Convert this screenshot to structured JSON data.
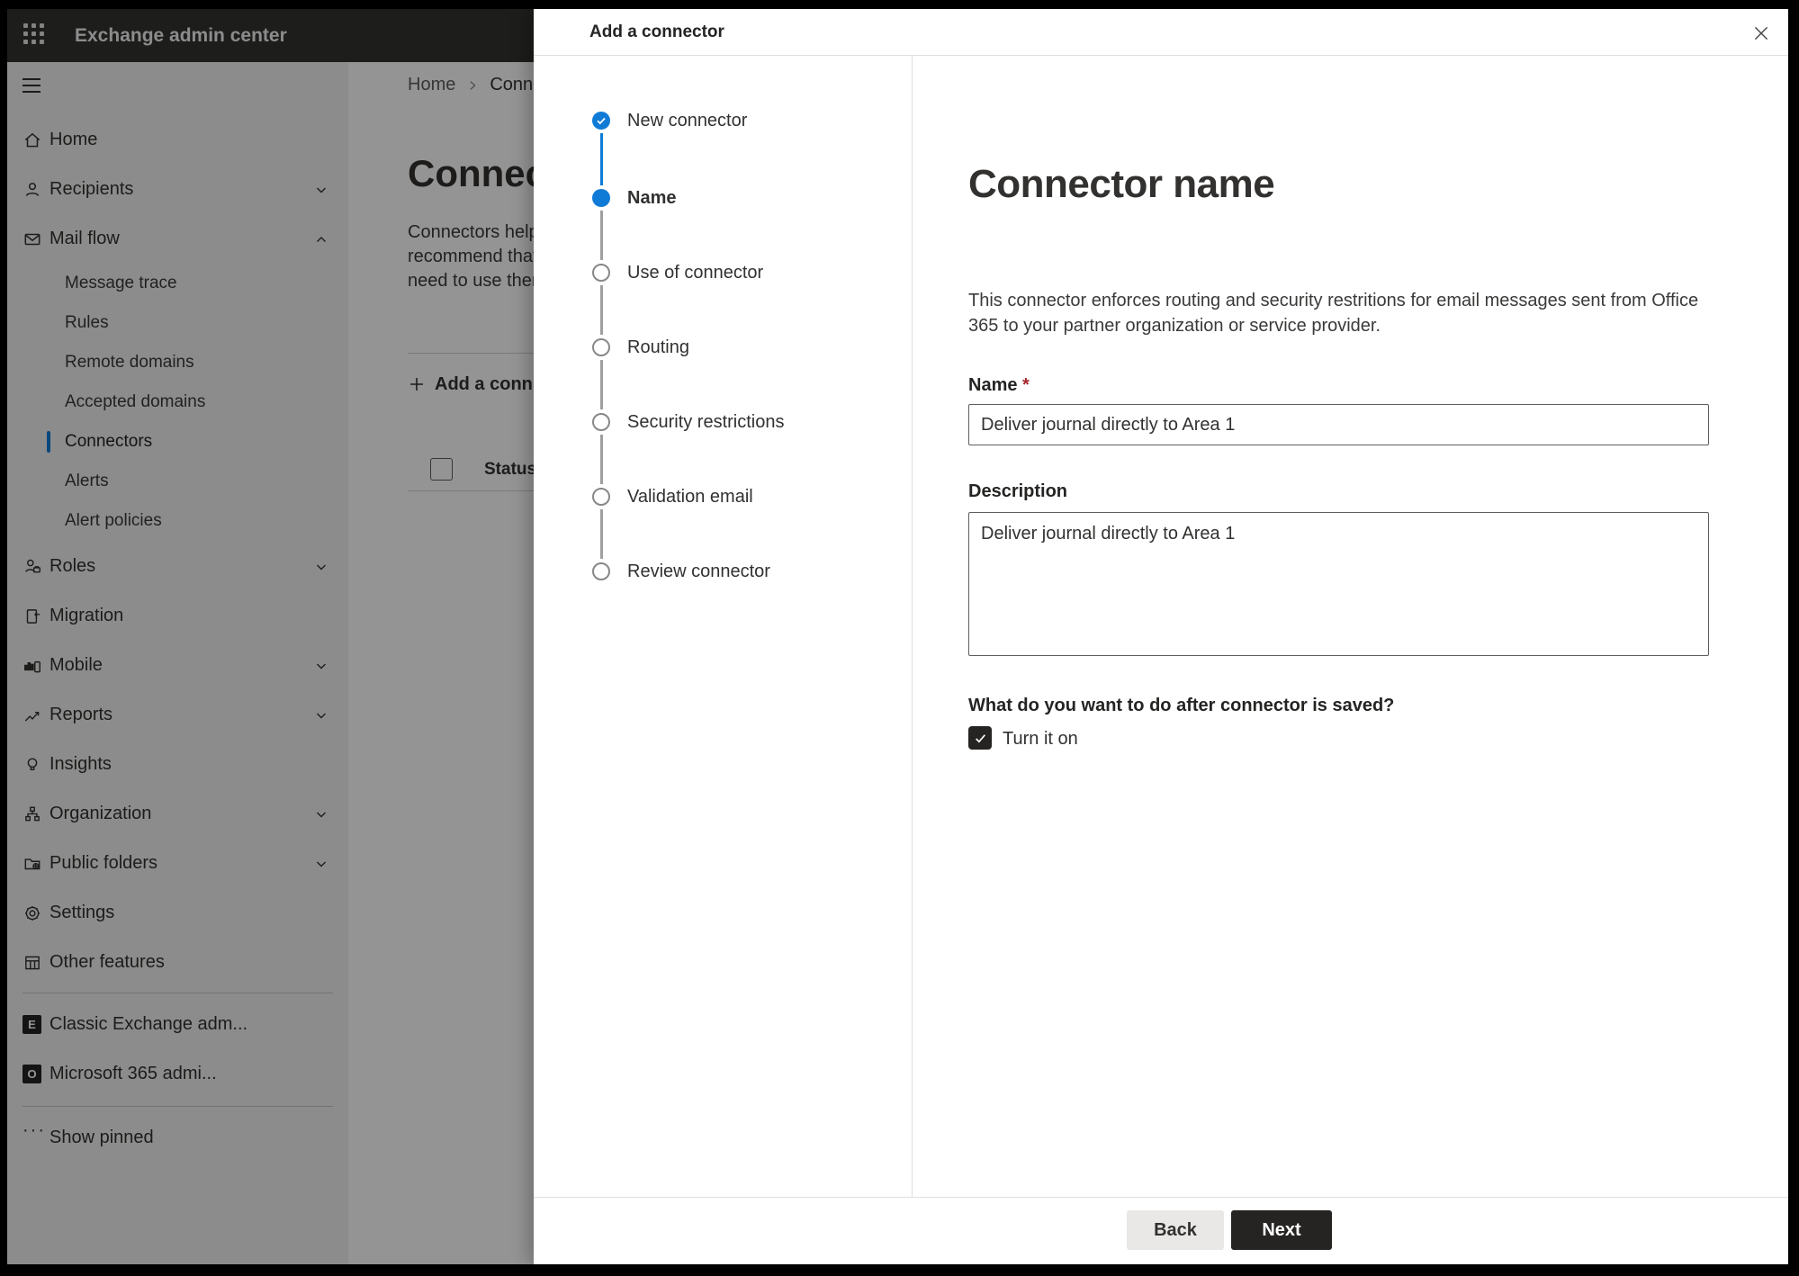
{
  "topbar": {
    "title": "Exchange admin center"
  },
  "sidebar": {
    "items": [
      {
        "label": "Home"
      },
      {
        "label": "Recipients",
        "expandable": true
      },
      {
        "label": "Mail flow",
        "expandable": true,
        "expanded": true
      },
      {
        "label": "Roles",
        "expandable": true
      },
      {
        "label": "Migration"
      },
      {
        "label": "Mobile",
        "expandable": true
      },
      {
        "label": "Reports",
        "expandable": true
      },
      {
        "label": "Insights"
      },
      {
        "label": "Organization",
        "expandable": true
      },
      {
        "label": "Public folders",
        "expandable": true
      },
      {
        "label": "Settings"
      },
      {
        "label": "Other features"
      }
    ],
    "mailflow_children": [
      {
        "label": "Message trace"
      },
      {
        "label": "Rules"
      },
      {
        "label": "Remote domains"
      },
      {
        "label": "Accepted domains"
      },
      {
        "label": "Connectors",
        "selected": true
      },
      {
        "label": "Alerts"
      },
      {
        "label": "Alert policies"
      }
    ],
    "footer_items": [
      {
        "label": "Classic Exchange adm..."
      },
      {
        "label": "Microsoft 365 admi..."
      }
    ],
    "show_pinned_label": "Show pinned"
  },
  "page": {
    "breadcrumb": {
      "home": "Home",
      "current": "Conne"
    },
    "title": "Connec",
    "intro_lines": [
      "Connectors help",
      "recommend that",
      "need to use ther"
    ],
    "add_button_label": "Add a conn",
    "table": {
      "status_header": "Status"
    }
  },
  "modal": {
    "title": "Add a connector",
    "steps": [
      {
        "label": "New connector",
        "state": "completed"
      },
      {
        "label": "Name",
        "state": "current"
      },
      {
        "label": "Use of connector",
        "state": "upcoming"
      },
      {
        "label": "Routing",
        "state": "upcoming"
      },
      {
        "label": "Security restrictions",
        "state": "upcoming"
      },
      {
        "label": "Validation email",
        "state": "upcoming"
      },
      {
        "label": "Review connector",
        "state": "upcoming"
      }
    ],
    "content": {
      "heading": "Connector name",
      "description": "This connector enforces routing and security restritions for email messages sent from Office 365 to your partner organization or service provider.",
      "name_label": "Name",
      "required_mark": "*",
      "name_value": "Deliver journal directly to Area 1",
      "description_label": "Description",
      "description_value": "Deliver journal directly to Area 1",
      "question": "What do you want to do after connector is saved?",
      "checkbox_label": "Turn it on",
      "checkbox_checked": true
    },
    "footer": {
      "back_label": "Back",
      "next_label": "Next"
    }
  },
  "colors": {
    "accent_blue": "#0f7bd6",
    "dark_button": "#252423",
    "required_red": "#a4262c",
    "topbar_bg": "#333231",
    "sidebar_bg": "#f3f2f1"
  }
}
